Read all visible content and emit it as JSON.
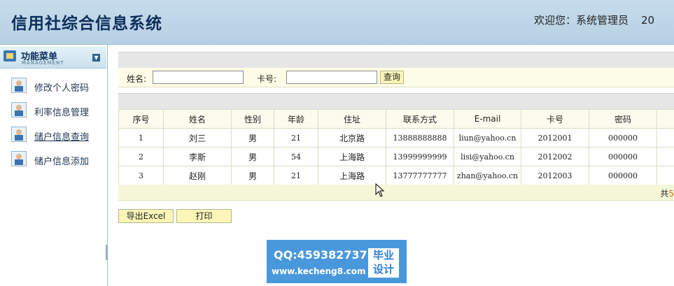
{
  "header": {
    "title": "信用社综合信息系统",
    "welcome": "欢迎您：系统管理员",
    "date_fragment": "20"
  },
  "sidebar": {
    "title": "功能菜单",
    "subtitle": "MANAGEMENT",
    "items": [
      {
        "label": "修改个人密码"
      },
      {
        "label": "利率信息管理"
      },
      {
        "label": "储户信息查询"
      },
      {
        "label": "储户信息添加"
      }
    ]
  },
  "search": {
    "name_label": "姓名:",
    "name_value": "",
    "card_label": "卡号:",
    "card_value": "",
    "query_button": "查询"
  },
  "table": {
    "columns": [
      "序号",
      "姓名",
      "性别",
      "年龄",
      "住址",
      "联系方式",
      "E-mail",
      "卡号",
      "密码",
      ""
    ],
    "rows": [
      [
        "1",
        "刘三",
        "男",
        "21",
        "北京路",
        "13888888888",
        "liun@yahoo.cn",
        "2012001",
        "000000",
        ""
      ],
      [
        "2",
        "李斯",
        "男",
        "54",
        "上海路",
        "13999999999",
        "lisi@yahoo.cn",
        "2012002",
        "000000",
        ""
      ],
      [
        "3",
        "赵刚",
        "男",
        "21",
        "上海路",
        "13777777777",
        "zhan@yahoo.cn",
        "2012003",
        "000000",
        ""
      ]
    ],
    "footer_prefix": "共",
    "footer_count": "5"
  },
  "actions": {
    "export_label": "导出Excel",
    "print_label": "打印"
  },
  "watermark": {
    "qq": "QQ:459382737",
    "url": "www.kecheng8.com",
    "badge_line1": "毕业",
    "badge_line2": "设计"
  }
}
